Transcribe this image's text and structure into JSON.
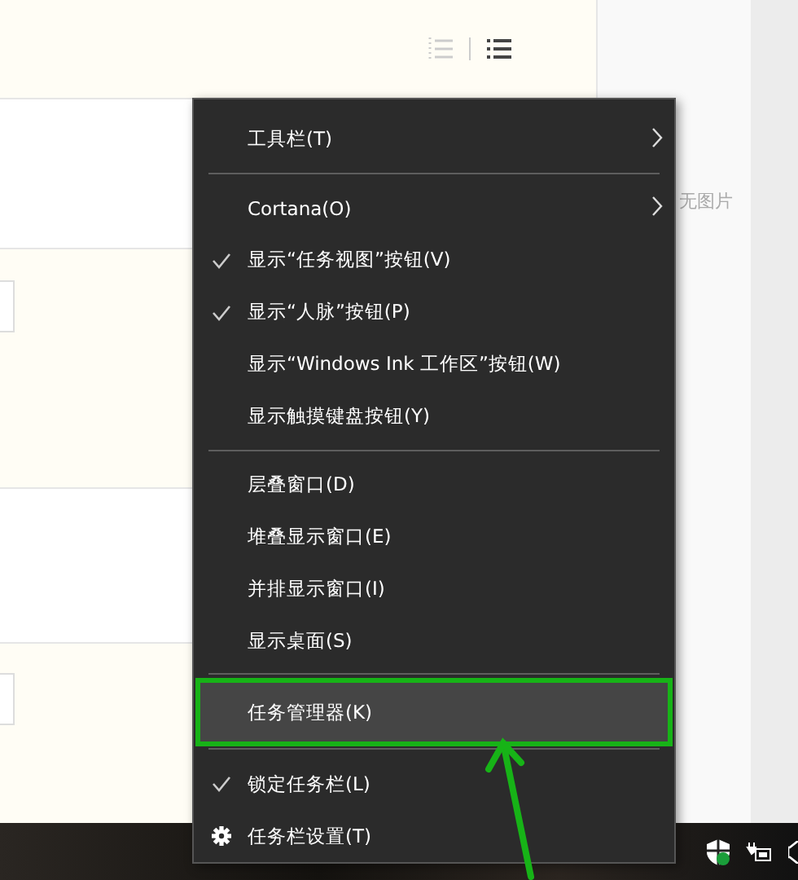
{
  "right_panel": {
    "text": "无图片"
  },
  "context_menu": {
    "items": [
      {
        "kind": "item",
        "label": "工具栏(T)",
        "checked": false,
        "submenu": true,
        "selected": false
      },
      {
        "kind": "separator"
      },
      {
        "kind": "item",
        "label": "Cortana(O)",
        "checked": false,
        "submenu": true,
        "selected": false
      },
      {
        "kind": "item",
        "label": "显示“任务视图”按钮(V)",
        "checked": true,
        "submenu": false,
        "selected": false
      },
      {
        "kind": "item",
        "label": "显示“人脉”按钮(P)",
        "checked": true,
        "submenu": false,
        "selected": false
      },
      {
        "kind": "item",
        "label": "显示“Windows Ink 工作区”按钮(W)",
        "checked": false,
        "submenu": false,
        "selected": false
      },
      {
        "kind": "item",
        "label": "显示触摸键盘按钮(Y)",
        "checked": false,
        "submenu": false,
        "selected": false
      },
      {
        "kind": "separator"
      },
      {
        "kind": "item",
        "label": "层叠窗口(D)",
        "checked": false,
        "submenu": false,
        "selected": false
      },
      {
        "kind": "item",
        "label": "堆叠显示窗口(E)",
        "checked": false,
        "submenu": false,
        "selected": false
      },
      {
        "kind": "item",
        "label": "并排显示窗口(I)",
        "checked": false,
        "submenu": false,
        "selected": false
      },
      {
        "kind": "item",
        "label": "显示桌面(S)",
        "checked": false,
        "submenu": false,
        "selected": false
      },
      {
        "kind": "separator"
      },
      {
        "kind": "item",
        "label": "任务管理器(K)",
        "checked": false,
        "submenu": false,
        "selected": true
      },
      {
        "kind": "separator"
      },
      {
        "kind": "item",
        "label": "锁定任务栏(L)",
        "checked": true,
        "submenu": false,
        "selected": false
      },
      {
        "kind": "settings",
        "label": "任务栏设置(T)",
        "checked": false,
        "submenu": false,
        "selected": false
      }
    ]
  }
}
